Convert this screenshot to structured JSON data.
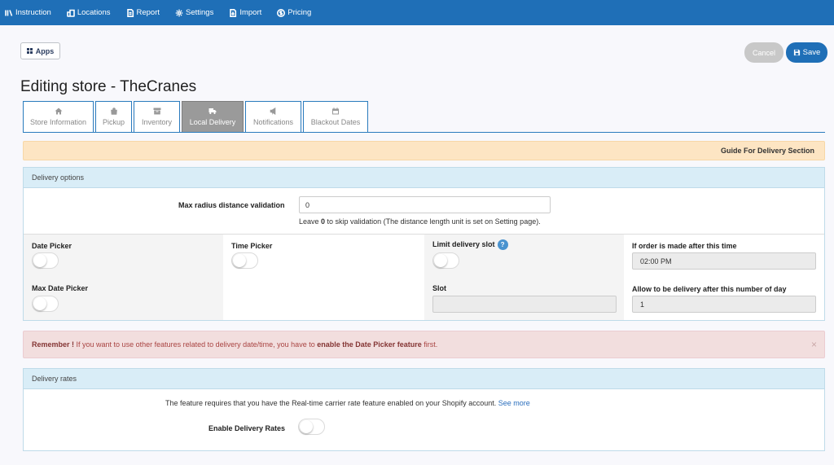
{
  "nav": {
    "items": [
      {
        "label": "Instruction",
        "icon": "book-icon"
      },
      {
        "label": "Locations",
        "icon": "buildings-icon"
      },
      {
        "label": "Report",
        "icon": "report-icon"
      },
      {
        "label": "Settings",
        "icon": "gear-icon"
      },
      {
        "label": "Import",
        "icon": "import-icon"
      },
      {
        "label": "Pricing",
        "icon": "dollar-circle-icon"
      }
    ]
  },
  "toolbar": {
    "apps_label": "Apps",
    "cancel_label": "Cancel",
    "save_label": "Save"
  },
  "page": {
    "title": "Editing store - TheCranes"
  },
  "tabs": [
    {
      "label": "Store Information",
      "icon": "home-icon",
      "active": false
    },
    {
      "label": "Pickup",
      "icon": "bag-icon",
      "active": false
    },
    {
      "label": "Inventory",
      "icon": "inventory-icon",
      "active": false
    },
    {
      "label": "Local Delivery",
      "icon": "truck-icon",
      "active": true
    },
    {
      "label": "Notifications",
      "icon": "megaphone-icon",
      "active": false
    },
    {
      "label": "Blackout Dates",
      "icon": "calendar-icon",
      "active": false
    }
  ],
  "guide": {
    "label": "Guide For Delivery Section"
  },
  "delivery_options": {
    "heading": "Delivery options",
    "max_radius": {
      "label": "Max radius distance validation",
      "value": "0",
      "help_prefix": "Leave ",
      "help_bold": "0",
      "help_suffix": " to skip validation (The distance length unit is set on Setting page)."
    },
    "date_picker": {
      "label": "Date Picker",
      "enabled": false
    },
    "max_date_picker": {
      "label": "Max Date Picker",
      "enabled": false
    },
    "time_picker": {
      "label": "Time Picker",
      "enabled": false
    },
    "limit_slot": {
      "label": "Limit delivery slot",
      "help": "?",
      "enabled": false
    },
    "slot": {
      "label": "Slot",
      "value": ""
    },
    "order_after": {
      "label": "If order is made after this time",
      "value": "02:00  PM"
    },
    "allow_after_days": {
      "label": "Allow to be delivery after this number of day",
      "value": "1"
    }
  },
  "alert": {
    "bold": "Remember !",
    "text_1": " If you want to use other features related to delivery date/time, you have to ",
    "bold_2": "enable the Date Picker feature",
    "text_2": " first.",
    "close": "×"
  },
  "delivery_rates": {
    "heading": "Delivery rates",
    "text": "The feature requires that you have the Real-time carrier rate feature enabled on your Shopify account. ",
    "link": "See more",
    "enable_label": "Enable Delivery Rates",
    "enabled": false
  },
  "colors": {
    "nav_bg": "#1f6fb7",
    "save_bg": "#1f6fb7",
    "cancel_bg": "#c8c8c8",
    "guide_bg": "#fde5c3",
    "panel_head_bg": "#d9edf7",
    "alert_bg": "#f2dede",
    "active_tab_bg": "#9a9a9a"
  }
}
